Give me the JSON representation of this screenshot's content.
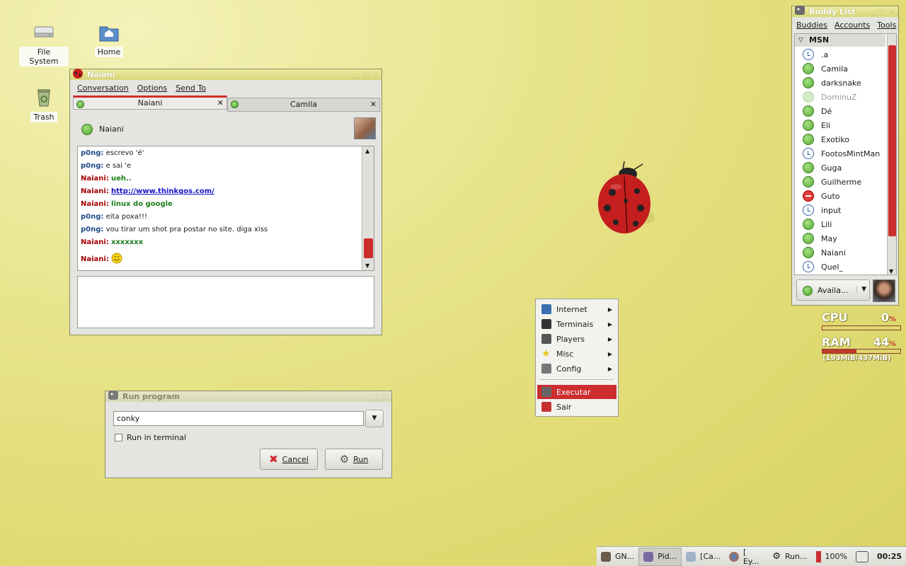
{
  "desktop": {
    "icons": [
      {
        "label": "File System",
        "icon": "drive-icon"
      },
      {
        "label": "Home",
        "icon": "home-folder-icon"
      },
      {
        "label": "Trash",
        "icon": "trash-icon"
      }
    ]
  },
  "chat_window": {
    "title": "Naiani",
    "menu": [
      "Conversation",
      "Options",
      "Send To"
    ],
    "tabs": [
      {
        "label": "Naiani",
        "active": true
      },
      {
        "label": "Camila",
        "active": false
      }
    ],
    "contact_name": "Naiani",
    "messages": [
      {
        "nick": "p0ng:",
        "text": "escrevo 'é'",
        "who": "me"
      },
      {
        "nick": "p0ng:",
        "text": "e sai 'e",
        "who": "me"
      },
      {
        "nick": "Naiani:",
        "text": "ueh..",
        "who": "them"
      },
      {
        "nick": "Naiani:",
        "text": "http://www.thinkgos.com/",
        "who": "them",
        "link": true
      },
      {
        "nick": "Naiani:",
        "text": "linux do google",
        "who": "them"
      },
      {
        "nick": "p0ng:",
        "text": "eita poxa!!!",
        "who": "me"
      },
      {
        "nick": "p0ng:",
        "text": "vou tirar um shot pra postar no site. diga xiss",
        "who": "me"
      },
      {
        "nick": "Naiani:",
        "text": "xxxxxxx",
        "who": "them"
      },
      {
        "nick": "Naiani:",
        "text": "",
        "who": "them",
        "emoticon": "smiley-icon"
      }
    ],
    "input_value": ""
  },
  "buddy_list": {
    "title": "Buddy List",
    "menu": [
      "Buddies",
      "Accounts",
      "Tools"
    ],
    "group": "MSN",
    "buddies": [
      {
        "name": ".a",
        "status": "idle"
      },
      {
        "name": "Camila",
        "status": "available"
      },
      {
        "name": "darksnake",
        "status": "available"
      },
      {
        "name": "DominuZ",
        "status": "offline"
      },
      {
        "name": "Dé",
        "status": "available"
      },
      {
        "name": "Eli",
        "status": "available"
      },
      {
        "name": "Exotiko",
        "status": "available"
      },
      {
        "name": "FootosMintMan",
        "status": "idle"
      },
      {
        "name": "Guga",
        "status": "available"
      },
      {
        "name": "Guilherme",
        "status": "available"
      },
      {
        "name": "Guto",
        "status": "busy"
      },
      {
        "name": "input",
        "status": "idle"
      },
      {
        "name": "Lili",
        "status": "available"
      },
      {
        "name": "May",
        "status": "available"
      },
      {
        "name": "Naiani",
        "status": "available"
      },
      {
        "name": "Quel_",
        "status": "idle"
      }
    ],
    "status_selector": "Availa..."
  },
  "conky": {
    "cpu_label": "CPU",
    "cpu_value": "0",
    "cpu_fraction": 0.0,
    "ram_label": "RAM",
    "ram_value": "44",
    "ram_fraction": 0.44,
    "percent_sign": "%",
    "ram_detail": "(193MiB/437MiB)"
  },
  "app_menu": {
    "items": [
      {
        "label": "Internet",
        "submenu": true,
        "icon": "globe-icon"
      },
      {
        "label": "Terminais",
        "submenu": true,
        "icon": "terminal-icon"
      },
      {
        "label": "Players",
        "submenu": true,
        "icon": "film-icon"
      },
      {
        "label": "Misc",
        "submenu": true,
        "icon": "star-icon"
      },
      {
        "label": "Config",
        "submenu": true,
        "icon": "config-icon"
      },
      {
        "label": "Executar",
        "submenu": false,
        "icon": "run-icon",
        "selected": true
      },
      {
        "label": "Sair",
        "submenu": false,
        "icon": "exit-icon"
      }
    ]
  },
  "run_dialog": {
    "title": "Run program",
    "command_value": "conky",
    "checkbox_label": "Run in terminal",
    "checkbox_checked": false,
    "cancel_label": "Cancel",
    "run_label": "Run"
  },
  "taskbar": {
    "tasks": [
      "GN...",
      "Pid...",
      "[Ca...",
      "[ Ey...",
      "Run..."
    ],
    "volume": "100%",
    "clock": "00:25"
  },
  "colors": {
    "accent": "#cc2d2d",
    "desktop": "#e2dc74"
  }
}
